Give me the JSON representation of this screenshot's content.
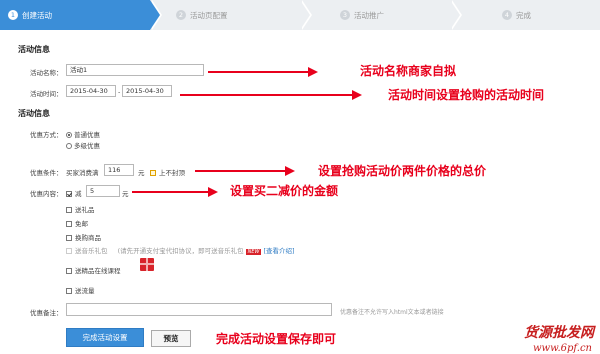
{
  "steps": [
    {
      "num": "1",
      "label": "创建活动"
    },
    {
      "num": "2",
      "label": "活动页配置"
    },
    {
      "num": "3",
      "label": "活动推广"
    },
    {
      "num": "4",
      "label": "完成"
    }
  ],
  "section1": {
    "title": "活动信息",
    "name_label": "活动名称：",
    "name_value": "活动1",
    "time_label": "活动时间：",
    "start_date": "2015-04-30",
    "date_sep": "-",
    "end_date": "2015-04-30"
  },
  "section2": {
    "title": "活动信息",
    "type_label": "优惠方式：",
    "type_options": [
      "普通优惠",
      "多级优惠"
    ],
    "cond_label": "优惠条件：",
    "cond_prefix": "买家消费满",
    "cond_value": "116",
    "cond_unit": "元",
    "cond_noceiling": "上不封顶",
    "content_label": "优惠内容：",
    "reduce_label": "减",
    "reduce_value": "5",
    "reduce_unit": "元",
    "options": [
      "送礼品",
      "免邮",
      "换购商品"
    ],
    "music_label": "送音乐礼包",
    "music_note_pre": "(请先开通支付宝代扣协议，即可送音乐礼包",
    "music_badge": "NEW",
    "music_link": "[查看介绍]",
    "course_label": "送精品在线课程",
    "traffic_label": "送流量",
    "remark_label": "优惠备注：",
    "remark_hint": "优惠备注不允许写入html文本或者链接"
  },
  "buttons": {
    "submit": "完成活动设置",
    "preview": "预览"
  },
  "annotations": {
    "a1": "活动名称商家自拟",
    "a2": "活动时间设置抢购的活动时间",
    "a3": "设置抢购活动价两件价格的总价",
    "a4": "设置买二减价的金额",
    "a5": "完成活动设置保存即可"
  },
  "watermark": {
    "line1": "货源批发网",
    "line2": "www.6pf.cn"
  },
  "colors": {
    "step_active": "#3b8ed8",
    "annotation": "#e8001c"
  }
}
